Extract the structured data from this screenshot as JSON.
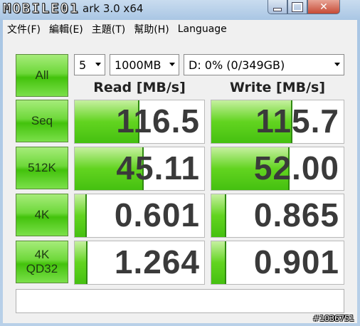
{
  "window": {
    "title": "ark 3.0 x64",
    "watermark": "MOBILE01"
  },
  "menu": [
    "文件(F)",
    "編輯(E)",
    "主題(T)",
    "幫助(H)",
    "Language"
  ],
  "controls": {
    "all_label": "All",
    "count_value": "5",
    "size_value": "1000MB",
    "drive_value": "D: 0% (0/349GB)"
  },
  "headers": {
    "read": "Read [MB/s]",
    "write": "Write [MB/s]"
  },
  "rows": [
    {
      "label": "Seq",
      "read": "116.5",
      "write": "115.7",
      "read_fill": 0.49,
      "write_fill": 0.6
    },
    {
      "label": "512K",
      "read": "45.11",
      "write": "52.00",
      "read_fill": 0.52,
      "write_fill": 0.58
    },
    {
      "label": "4K",
      "read": "0.601",
      "write": "0.865",
      "read_fill": 0.08,
      "write_fill": 0.1
    },
    {
      "label": "4K\nQD32",
      "read": "1.264",
      "write": "0.901",
      "read_fill": 0.09,
      "write_fill": 0.1
    }
  ],
  "badge": "#1036751",
  "colors": {
    "accent_green": "#43c20c",
    "window_blue": "#a9c6e4",
    "close_red": "#c64a35"
  }
}
